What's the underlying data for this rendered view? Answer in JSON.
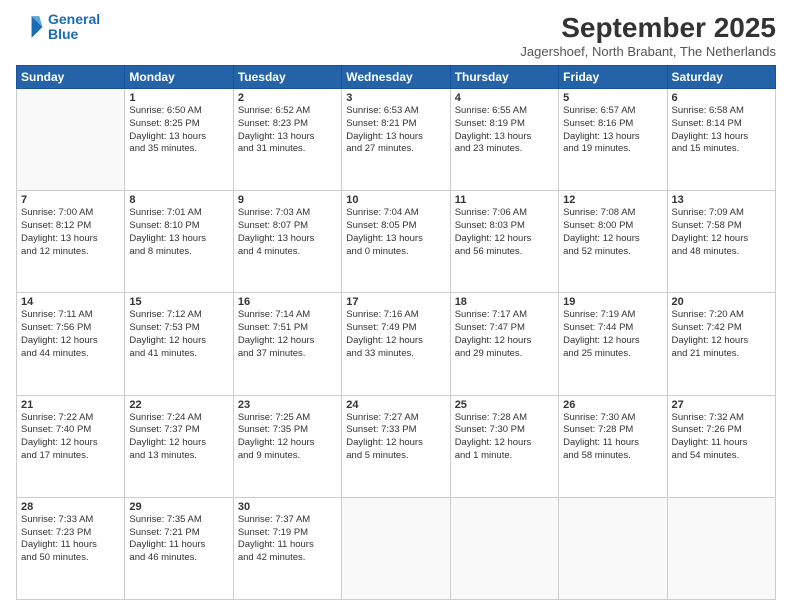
{
  "logo": {
    "line1": "General",
    "line2": "Blue"
  },
  "title": "September 2025",
  "subtitle": "Jagershoef, North Brabant, The Netherlands",
  "headers": [
    "Sunday",
    "Monday",
    "Tuesday",
    "Wednesday",
    "Thursday",
    "Friday",
    "Saturday"
  ],
  "weeks": [
    [
      {
        "day": "",
        "info": ""
      },
      {
        "day": "1",
        "info": "Sunrise: 6:50 AM\nSunset: 8:25 PM\nDaylight: 13 hours\nand 35 minutes."
      },
      {
        "day": "2",
        "info": "Sunrise: 6:52 AM\nSunset: 8:23 PM\nDaylight: 13 hours\nand 31 minutes."
      },
      {
        "day": "3",
        "info": "Sunrise: 6:53 AM\nSunset: 8:21 PM\nDaylight: 13 hours\nand 27 minutes."
      },
      {
        "day": "4",
        "info": "Sunrise: 6:55 AM\nSunset: 8:19 PM\nDaylight: 13 hours\nand 23 minutes."
      },
      {
        "day": "5",
        "info": "Sunrise: 6:57 AM\nSunset: 8:16 PM\nDaylight: 13 hours\nand 19 minutes."
      },
      {
        "day": "6",
        "info": "Sunrise: 6:58 AM\nSunset: 8:14 PM\nDaylight: 13 hours\nand 15 minutes."
      }
    ],
    [
      {
        "day": "7",
        "info": "Sunrise: 7:00 AM\nSunset: 8:12 PM\nDaylight: 13 hours\nand 12 minutes."
      },
      {
        "day": "8",
        "info": "Sunrise: 7:01 AM\nSunset: 8:10 PM\nDaylight: 13 hours\nand 8 minutes."
      },
      {
        "day": "9",
        "info": "Sunrise: 7:03 AM\nSunset: 8:07 PM\nDaylight: 13 hours\nand 4 minutes."
      },
      {
        "day": "10",
        "info": "Sunrise: 7:04 AM\nSunset: 8:05 PM\nDaylight: 13 hours\nand 0 minutes."
      },
      {
        "day": "11",
        "info": "Sunrise: 7:06 AM\nSunset: 8:03 PM\nDaylight: 12 hours\nand 56 minutes."
      },
      {
        "day": "12",
        "info": "Sunrise: 7:08 AM\nSunset: 8:00 PM\nDaylight: 12 hours\nand 52 minutes."
      },
      {
        "day": "13",
        "info": "Sunrise: 7:09 AM\nSunset: 7:58 PM\nDaylight: 12 hours\nand 48 minutes."
      }
    ],
    [
      {
        "day": "14",
        "info": "Sunrise: 7:11 AM\nSunset: 7:56 PM\nDaylight: 12 hours\nand 44 minutes."
      },
      {
        "day": "15",
        "info": "Sunrise: 7:12 AM\nSunset: 7:53 PM\nDaylight: 12 hours\nand 41 minutes."
      },
      {
        "day": "16",
        "info": "Sunrise: 7:14 AM\nSunset: 7:51 PM\nDaylight: 12 hours\nand 37 minutes."
      },
      {
        "day": "17",
        "info": "Sunrise: 7:16 AM\nSunset: 7:49 PM\nDaylight: 12 hours\nand 33 minutes."
      },
      {
        "day": "18",
        "info": "Sunrise: 7:17 AM\nSunset: 7:47 PM\nDaylight: 12 hours\nand 29 minutes."
      },
      {
        "day": "19",
        "info": "Sunrise: 7:19 AM\nSunset: 7:44 PM\nDaylight: 12 hours\nand 25 minutes."
      },
      {
        "day": "20",
        "info": "Sunrise: 7:20 AM\nSunset: 7:42 PM\nDaylight: 12 hours\nand 21 minutes."
      }
    ],
    [
      {
        "day": "21",
        "info": "Sunrise: 7:22 AM\nSunset: 7:40 PM\nDaylight: 12 hours\nand 17 minutes."
      },
      {
        "day": "22",
        "info": "Sunrise: 7:24 AM\nSunset: 7:37 PM\nDaylight: 12 hours\nand 13 minutes."
      },
      {
        "day": "23",
        "info": "Sunrise: 7:25 AM\nSunset: 7:35 PM\nDaylight: 12 hours\nand 9 minutes."
      },
      {
        "day": "24",
        "info": "Sunrise: 7:27 AM\nSunset: 7:33 PM\nDaylight: 12 hours\nand 5 minutes."
      },
      {
        "day": "25",
        "info": "Sunrise: 7:28 AM\nSunset: 7:30 PM\nDaylight: 12 hours\nand 1 minute."
      },
      {
        "day": "26",
        "info": "Sunrise: 7:30 AM\nSunset: 7:28 PM\nDaylight: 11 hours\nand 58 minutes."
      },
      {
        "day": "27",
        "info": "Sunrise: 7:32 AM\nSunset: 7:26 PM\nDaylight: 11 hours\nand 54 minutes."
      }
    ],
    [
      {
        "day": "28",
        "info": "Sunrise: 7:33 AM\nSunset: 7:23 PM\nDaylight: 11 hours\nand 50 minutes."
      },
      {
        "day": "29",
        "info": "Sunrise: 7:35 AM\nSunset: 7:21 PM\nDaylight: 11 hours\nand 46 minutes."
      },
      {
        "day": "30",
        "info": "Sunrise: 7:37 AM\nSunset: 7:19 PM\nDaylight: 11 hours\nand 42 minutes."
      },
      {
        "day": "",
        "info": ""
      },
      {
        "day": "",
        "info": ""
      },
      {
        "day": "",
        "info": ""
      },
      {
        "day": "",
        "info": ""
      }
    ]
  ]
}
